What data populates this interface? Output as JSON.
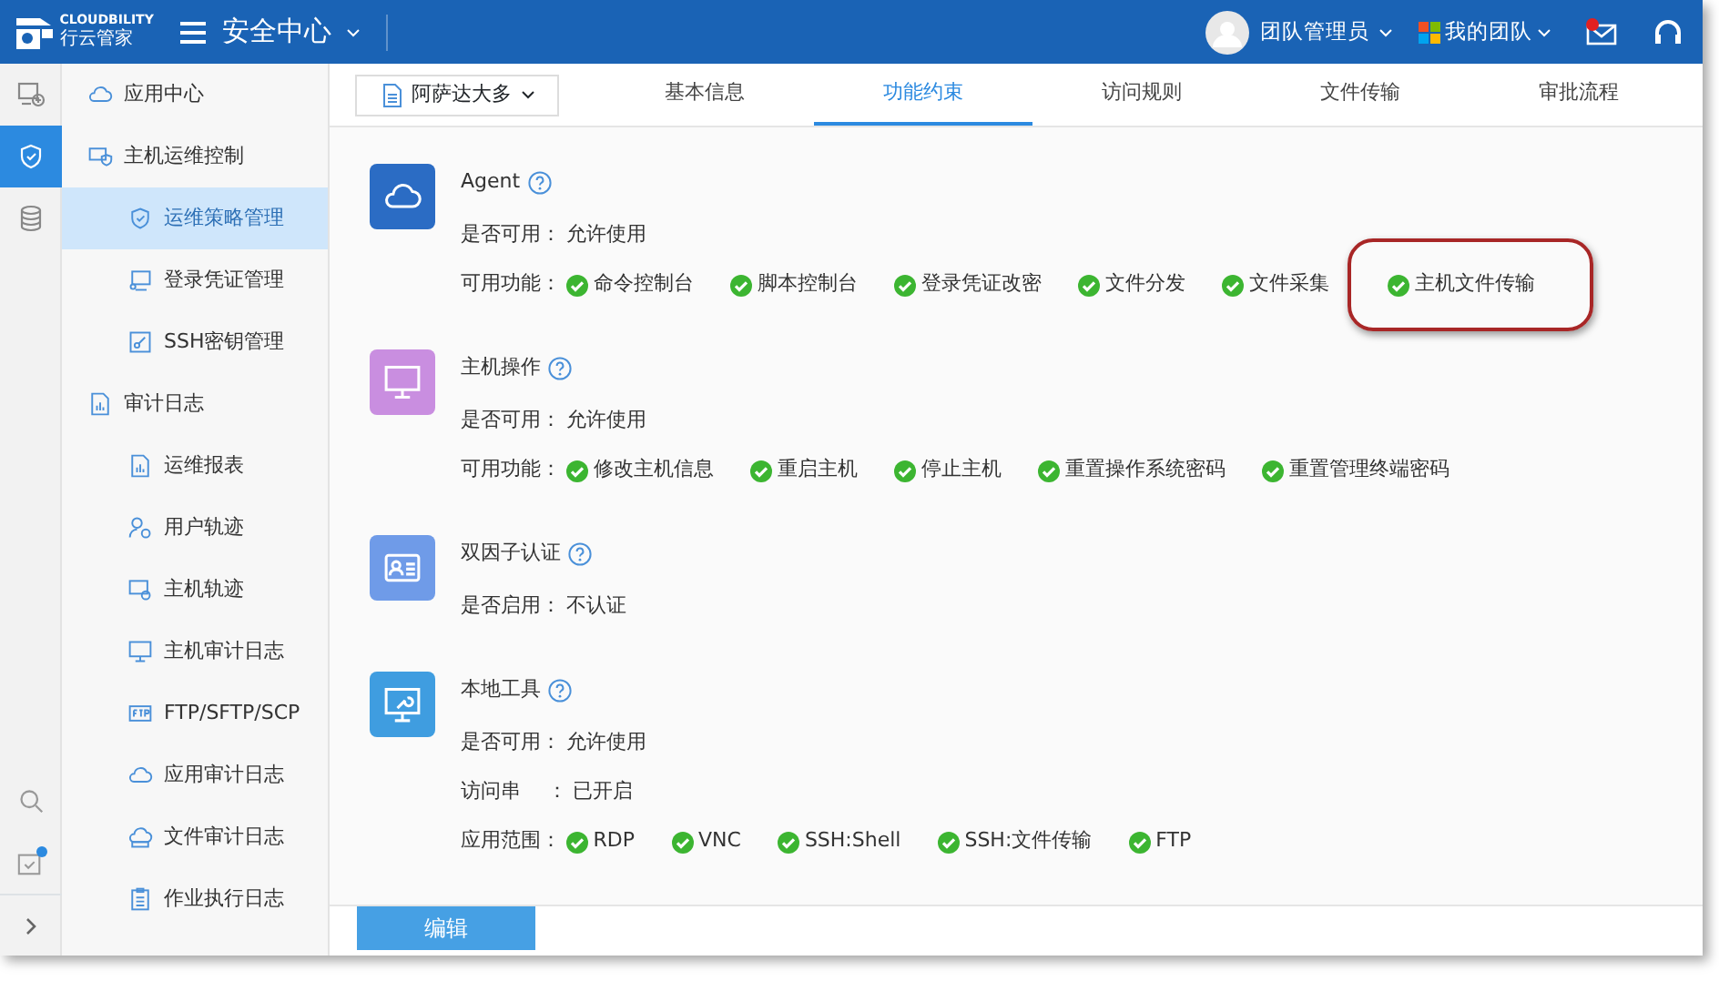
{
  "header": {
    "logo_text": "CLOUDBILITY",
    "logo_subtext": "行云管家",
    "title": "安全中心",
    "user": "团队管理员",
    "team": "我的团队",
    "mail_unread": true
  },
  "rail": [
    {
      "selected": false
    },
    {
      "selected": true
    },
    {
      "selected": false
    }
  ],
  "rail_bottom": {
    "task_badge": true
  },
  "sidebar": {
    "items": [
      {
        "label": "应用中心",
        "selected": false
      },
      {
        "label": "主机运维控制",
        "selected": false,
        "children": [
          {
            "label": "运维策略管理",
            "selected": true
          },
          {
            "label": "登录凭证管理",
            "selected": false
          },
          {
            "label": "SSH密钥管理",
            "selected": false
          }
        ]
      },
      {
        "label": "审计日志",
        "selected": false,
        "children": [
          {
            "label": "运维报表",
            "selected": false
          },
          {
            "label": "用户轨迹",
            "selected": false
          },
          {
            "label": "主机轨迹",
            "selected": false
          },
          {
            "label": "主机审计日志",
            "selected": false
          },
          {
            "label": "FTP/SFTP/SCP",
            "selected": false
          },
          {
            "label": "应用审计日志",
            "selected": false
          },
          {
            "label": "文件审计日志",
            "selected": false
          },
          {
            "label": "作业执行日志",
            "selected": false
          }
        ]
      }
    ]
  },
  "host_selector": "阿萨达大多",
  "tabs": [
    {
      "label": "基本信息",
      "selected": false
    },
    {
      "label": "功能约束",
      "selected": true
    },
    {
      "label": "访问规则",
      "selected": false
    },
    {
      "label": "文件传输",
      "selected": false
    },
    {
      "label": "审批流程",
      "selected": false
    }
  ],
  "sections": [
    {
      "title": "Agent",
      "color": "#2b6cc4",
      "rows": [
        {
          "label": "是否可用：",
          "value": "允许使用"
        },
        {
          "label": "可用功能：",
          "items": [
            {
              "label": "命令控制台",
              "highlighted": false
            },
            {
              "label": "脚本控制台",
              "highlighted": false
            },
            {
              "label": "登录凭证改密",
              "highlighted": false
            },
            {
              "label": "文件分发",
              "highlighted": false
            },
            {
              "label": "文件采集",
              "highlighted": false
            },
            {
              "label": "主机文件传输",
              "highlighted": true
            }
          ]
        }
      ]
    },
    {
      "title": "主机操作",
      "color": "#c98ee0",
      "rows": [
        {
          "label": "是否可用：",
          "value": "允许使用"
        },
        {
          "label": "可用功能：",
          "items": [
            {
              "label": "修改主机信息",
              "highlighted": false
            },
            {
              "label": "重启主机",
              "highlighted": false
            },
            {
              "label": "停止主机",
              "highlighted": false
            },
            {
              "label": "重置操作系统密码",
              "highlighted": false
            },
            {
              "label": "重置管理终端密码",
              "highlighted": false
            }
          ]
        }
      ]
    },
    {
      "title": "双因子认证",
      "color": "#6f9be8",
      "rows": [
        {
          "label": "是否启用：",
          "value": "不认证"
        }
      ]
    },
    {
      "title": "本地工具",
      "color": "#3f9de0",
      "rows": [
        {
          "label": "是否可用：",
          "value": "允许使用"
        },
        {
          "label": "访问串　 ：",
          "value": "已开启"
        },
        {
          "label": "应用范围：",
          "items": [
            {
              "label": "RDP",
              "highlighted": false
            },
            {
              "label": "VNC",
              "highlighted": false
            },
            {
              "label": "SSH:Shell",
              "highlighted": false
            },
            {
              "label": "SSH:文件传输",
              "highlighted": false
            },
            {
              "label": "FTP",
              "highlighted": false
            }
          ]
        }
      ]
    }
  ],
  "edit_button": "编辑"
}
